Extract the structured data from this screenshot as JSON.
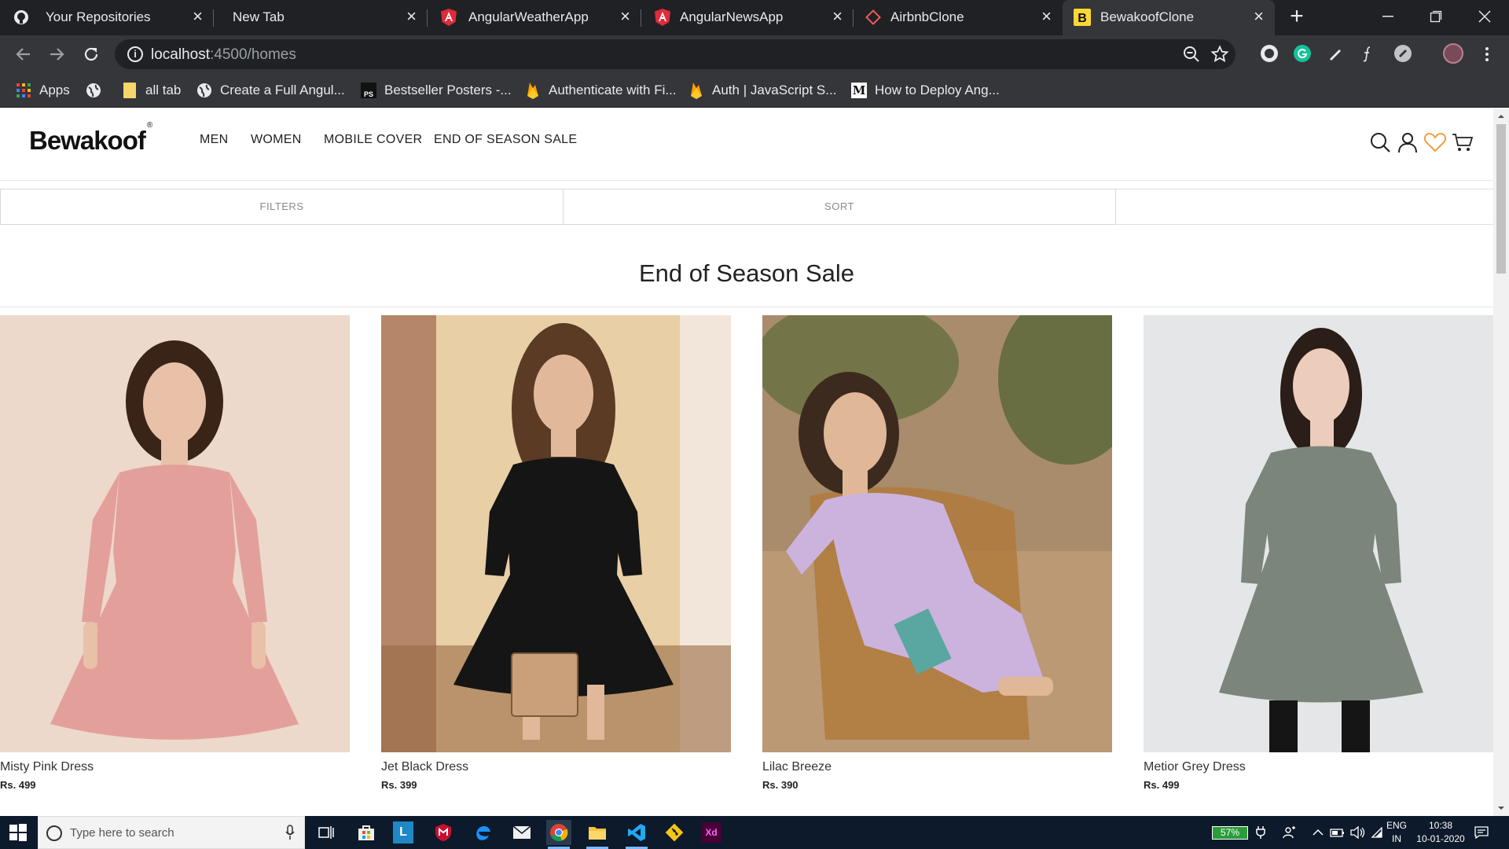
{
  "browser": {
    "tabs": [
      {
        "title": "Your Repositories",
        "icon": "github-icon"
      },
      {
        "title": "New Tab",
        "icon": "none"
      },
      {
        "title": "AngularWeatherApp",
        "icon": "angular-icon"
      },
      {
        "title": "AngularNewsApp",
        "icon": "angular-icon"
      },
      {
        "title": "AirbnbClone",
        "icon": "airbnb-icon"
      },
      {
        "title": "BewakoofClone",
        "icon": "bewakoof-b-icon"
      }
    ],
    "tab_close": "×",
    "new_tab": "+",
    "address": {
      "host": "localhost",
      "path": ":4500/homes"
    },
    "bookmarks": [
      {
        "label": "Apps",
        "icon": "apps-grid-icon"
      },
      {
        "label": "",
        "icon": "globe-icon"
      },
      {
        "label": "all tab",
        "icon": "folder-icon"
      },
      {
        "label": "Create a Full Angul...",
        "icon": "globe-icon"
      },
      {
        "label": "Bestseller Posters -...",
        "icon": "ps-icon"
      },
      {
        "label": "Authenticate with Fi...",
        "icon": "firebase-icon"
      },
      {
        "label": "Auth | JavaScript S...",
        "icon": "firebase-icon"
      },
      {
        "label": "How to Deploy Ang...",
        "icon": "medium-m-icon"
      }
    ],
    "bookmark_icon_text": {
      "ps": "PS",
      "medium": "M"
    }
  },
  "site": {
    "logo": "Bewakoof",
    "logo_mark": "®",
    "nav": [
      "MEN",
      "WOMEN",
      "MOBILE COVER",
      "END OF SEASON SALE"
    ],
    "filters": [
      "FILTERS",
      "SORT"
    ],
    "section_title": "End of Season Sale",
    "products": [
      {
        "name": "Misty Pink Dress",
        "price": "Rs. 499",
        "dress_color": "#e3a09a",
        "bg_color": "#ecd9cb",
        "skin": "#e8c1a8",
        "hair": "#3a2418"
      },
      {
        "name": "Jet Black Dress",
        "price": "Rs. 399",
        "dress_color": "#151515",
        "bg_color": "#e9cfa6",
        "skin": "#e2b89b",
        "hair": "#5b3b24"
      },
      {
        "name": "Lilac Breeze",
        "price": "Rs. 390",
        "dress_color": "#cbb3de",
        "bg_color": "#a88c6b",
        "skin": "#e0b797",
        "hair": "#3d2a1e"
      },
      {
        "name": "Metior Grey Dress",
        "price": "Rs. 499",
        "dress_color": "#7c857c",
        "bg_color": "#e4e6e8",
        "skin": "#ecccbb",
        "hair": "#2b1d17"
      }
    ]
  },
  "taskbar": {
    "search_placeholder": "Type here to search",
    "apps": [
      "task-view-icon",
      "store-icon",
      "l-app-icon",
      "mcafee-icon",
      "edge-icon",
      "mail-icon",
      "chrome-icon",
      "file-explorer-icon",
      "vscode-icon",
      "git-icon",
      "xd-icon"
    ],
    "app_text": {
      "l": "L",
      "xd": "Xd"
    },
    "battery": "57%",
    "lang_top": "ENG",
    "lang_bottom": "IN",
    "time": "10:38",
    "date": "10-01-2020"
  }
}
